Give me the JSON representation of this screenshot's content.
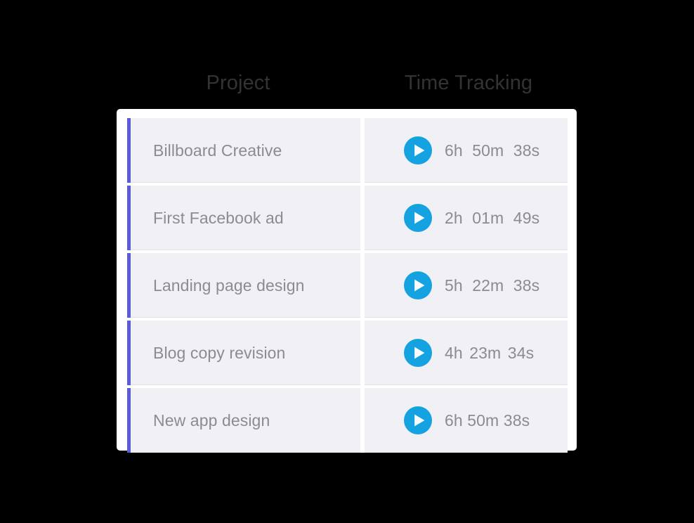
{
  "table": {
    "headers": {
      "project": "Project",
      "time_tracking": "Time Tracking"
    },
    "accent_color": "#5b5bdb",
    "play_button_color": "#14a3e0",
    "row_background": "#f1f0f4",
    "card_background": "#ffffff",
    "text_color": "#8b8b90",
    "header_text_color": "#333336",
    "rows": [
      {
        "project": "Billboard Creative",
        "time": "6h  50m  38s",
        "play_icon": "play-icon",
        "spacing": "wide"
      },
      {
        "project": "First Facebook ad",
        "time": "2h  01m  49s",
        "play_icon": "play-icon",
        "spacing": "wide"
      },
      {
        "project": "Landing page design",
        "time": "5h  22m  38s",
        "play_icon": "play-icon",
        "spacing": "wide"
      },
      {
        "project": "Blog copy revision",
        "time": "4h  23m 34s",
        "play_icon": "play-icon",
        "spacing": "mid"
      },
      {
        "project": "New app design",
        "time": "6h 50m 38s",
        "play_icon": "play-icon",
        "spacing": "tight"
      }
    ]
  }
}
